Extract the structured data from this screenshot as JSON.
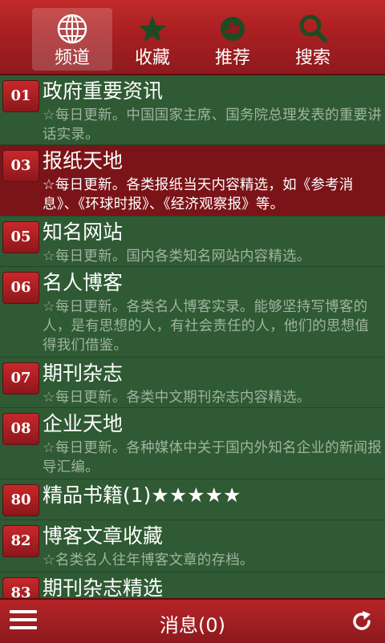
{
  "tabs": [
    {
      "label": "频道",
      "icon": "globe-icon",
      "active": true
    },
    {
      "label": "收藏",
      "icon": "star-icon",
      "active": false
    },
    {
      "label": "推荐",
      "icon": "recommend-icon",
      "active": false
    },
    {
      "label": "搜索",
      "icon": "search-icon",
      "active": false
    }
  ],
  "channels": [
    {
      "num": "01",
      "title": "政府重要资讯",
      "desc": "☆每日更新。中国国家主席、国务院总理发表的重要讲话实录。"
    },
    {
      "num": "03",
      "title": "报纸天地",
      "desc": "☆每日更新。各类报纸当天内容精选，如《参考消息》、《环球时报》、《经济观察报》等。"
    },
    {
      "num": "05",
      "title": "知名网站",
      "desc": "☆每日更新。国内各类知名网站内容精选。"
    },
    {
      "num": "06",
      "title": "名人博客",
      "desc": "☆每日更新。各类名人博客实录。能够坚持写博客的人，是有思想的人，有社会责任的人，他们的思想值得我们借鉴。"
    },
    {
      "num": "07",
      "title": "期刊杂志",
      "desc": "☆每日更新。各类中文期刊杂志内容精选。"
    },
    {
      "num": "08",
      "title": "企业天地",
      "desc": "☆每日更新。各种媒体中关于国内外知名企业的新闻报导汇编。"
    },
    {
      "num": "80",
      "title": "精品书籍(1)★★★★★",
      "desc": ""
    },
    {
      "num": "82",
      "title": "博客文章收藏",
      "desc": "☆名类名人往年博客文章的存档。"
    },
    {
      "num": "83",
      "title": "期刊杂志精选",
      "desc": ""
    }
  ],
  "bottom": {
    "message": "消息(0)",
    "menu_icon": "menu-icon",
    "refresh_icon": "refresh-icon"
  }
}
